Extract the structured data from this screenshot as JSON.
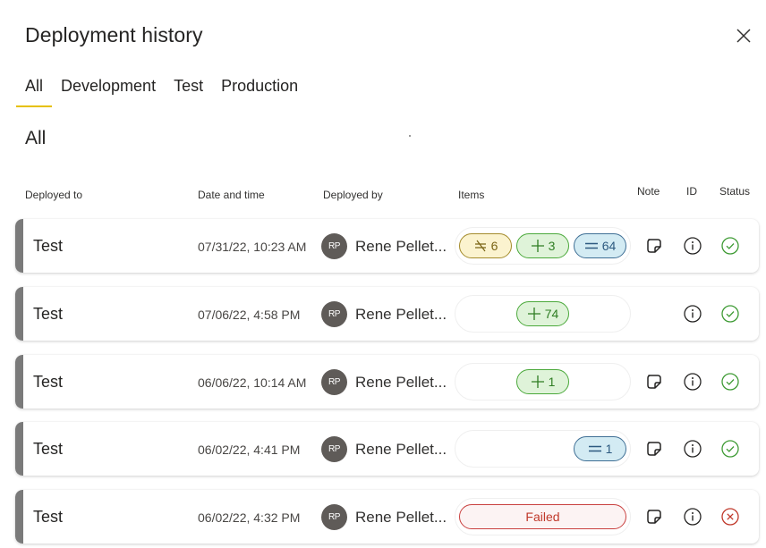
{
  "dialog": {
    "title": "Deployment history",
    "close_icon": "close-icon"
  },
  "tabs": [
    {
      "label": "All",
      "active": true
    },
    {
      "label": "Development",
      "active": false
    },
    {
      "label": "Test",
      "active": false
    },
    {
      "label": "Production",
      "active": false
    }
  ],
  "section_title": "All",
  "columns": {
    "deployed_to": "Deployed to",
    "date_time": "Date and time",
    "deployed_by": "Deployed by",
    "items": "Items",
    "note": "Note",
    "id": "ID",
    "status": "Status"
  },
  "colors": {
    "tab_underline": "#e6c000",
    "stripe": "#7a7a7a",
    "success": "#3f9b35",
    "failed": "#c0392b"
  },
  "rows": [
    {
      "deployed_to": "Test",
      "date_time": "07/31/22, 10:23 AM",
      "avatar_initials": "RP",
      "deployed_by": "Rene Pellet...",
      "items": [
        {
          "type": "different",
          "icon": "not-equal-icon",
          "count": "6"
        },
        {
          "type": "new",
          "icon": "plus-icon",
          "count": "3"
        },
        {
          "type": "same",
          "icon": "equal-icon",
          "count": "64"
        }
      ],
      "has_note": true,
      "status": "success"
    },
    {
      "deployed_to": "Test",
      "date_time": "07/06/22, 4:58 PM",
      "avatar_initials": "RP",
      "deployed_by": "Rene Pellet...",
      "items": [
        {
          "type": "new",
          "icon": "plus-icon",
          "count": "74"
        }
      ],
      "has_note": false,
      "status": "success"
    },
    {
      "deployed_to": "Test",
      "date_time": "06/06/22, 10:14 AM",
      "avatar_initials": "RP",
      "deployed_by": "Rene Pellet...",
      "items": [
        {
          "type": "new",
          "icon": "plus-icon",
          "count": "1"
        }
      ],
      "has_note": true,
      "status": "success"
    },
    {
      "deployed_to": "Test",
      "date_time": "06/02/22, 4:41 PM",
      "avatar_initials": "RP",
      "deployed_by": "Rene Pellet...",
      "items": [
        {
          "type": "same",
          "icon": "equal-icon",
          "count": "1"
        }
      ],
      "has_note": true,
      "status": "success"
    },
    {
      "deployed_to": "Test",
      "date_time": "06/02/22, 4:32 PM",
      "avatar_initials": "RP",
      "deployed_by": "Rene Pellet...",
      "items_failed_label": "Failed",
      "has_note": true,
      "status": "failed"
    }
  ]
}
